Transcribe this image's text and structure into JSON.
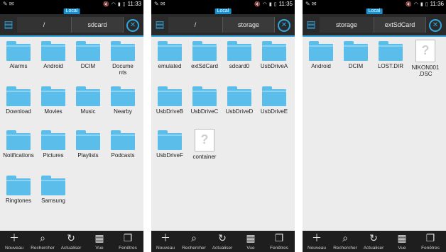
{
  "panels": [
    {
      "status": {
        "time": "11:33",
        "left_icons": "✎ ✉"
      },
      "tag": "Local",
      "breadcrumbs": [
        "/",
        "sdcard"
      ],
      "items": [
        {
          "label": "Alarms",
          "type": "folder"
        },
        {
          "label": "Android",
          "type": "folder"
        },
        {
          "label": "DCIM",
          "type": "folder"
        },
        {
          "label": "Documents",
          "type": "folder"
        },
        {
          "label": "Download",
          "type": "folder"
        },
        {
          "label": "Movies",
          "type": "folder"
        },
        {
          "label": "Music",
          "type": "folder"
        },
        {
          "label": "Nearby",
          "type": "folder"
        },
        {
          "label": "Notifications",
          "type": "folder"
        },
        {
          "label": "Pictures",
          "type": "folder"
        },
        {
          "label": "Playlists",
          "type": "folder"
        },
        {
          "label": "Podcasts",
          "type": "folder"
        },
        {
          "label": "Ringtones",
          "type": "folder"
        },
        {
          "label": "Samsung",
          "type": "folder"
        }
      ]
    },
    {
      "status": {
        "time": "11:35",
        "left_icons": "✎ ✉"
      },
      "tag": "Local",
      "breadcrumbs": [
        "/",
        "storage"
      ],
      "items": [
        {
          "label": "emulated",
          "type": "folder"
        },
        {
          "label": "extSdCard",
          "type": "folder"
        },
        {
          "label": "sdcard0",
          "type": "folder"
        },
        {
          "label": "UsbDriveA",
          "type": "folder"
        },
        {
          "label": "UsbDriveB",
          "type": "folder"
        },
        {
          "label": "UsbDriveC",
          "type": "folder"
        },
        {
          "label": "UsbDriveD",
          "type": "folder"
        },
        {
          "label": "UsbDriveE",
          "type": "folder"
        },
        {
          "label": "UsbDriveF",
          "type": "folder"
        },
        {
          "label": "container",
          "type": "file"
        }
      ]
    },
    {
      "status": {
        "time": "11:36",
        "left_icons": "✎ ✉"
      },
      "tag": "Local",
      "breadcrumbs": [
        "storage",
        "extSdCard"
      ],
      "items": [
        {
          "label": "Android",
          "type": "folder"
        },
        {
          "label": "DCIM",
          "type": "folder"
        },
        {
          "label": "LOST.DIR",
          "type": "folder"
        },
        {
          "label": "NIKON001.DSC",
          "type": "file"
        }
      ]
    }
  ],
  "toolbar": [
    {
      "label": "Nouveau",
      "icon": "plus-icon"
    },
    {
      "label": "Rechercher",
      "icon": "search-icon"
    },
    {
      "label": "Actualiser",
      "icon": "refresh-icon"
    },
    {
      "label": "Vue",
      "icon": "grid-icon"
    },
    {
      "label": "Fenêtres",
      "icon": "windows-icon"
    }
  ],
  "colors": {
    "accent": "#31a6e0",
    "folder": "#5bbde9",
    "bar": "#1e1e1e",
    "background": "#ececec"
  }
}
